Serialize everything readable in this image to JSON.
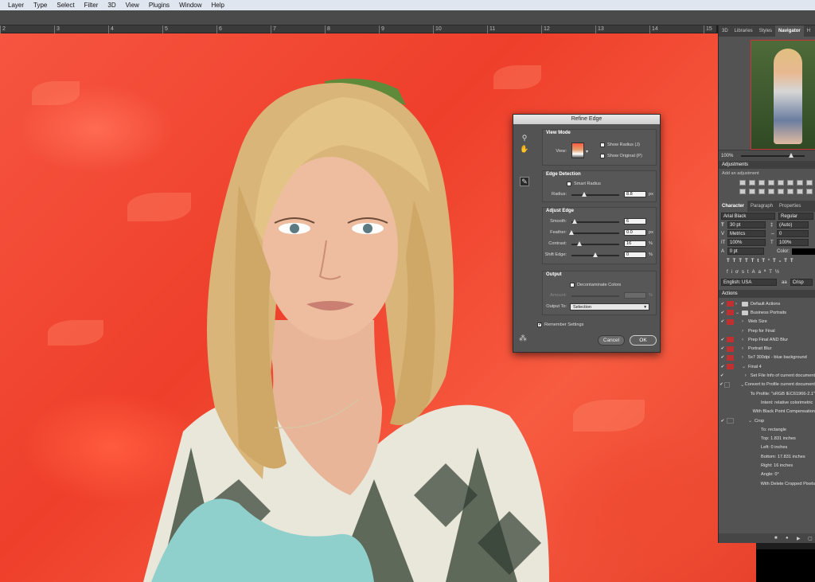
{
  "menubar": {
    "items": [
      "Layer",
      "Type",
      "Select",
      "Filter",
      "3D",
      "View",
      "Plugins",
      "Window",
      "Help"
    ]
  },
  "ruler": {
    "ticks": [
      "2",
      "3",
      "4",
      "5",
      "6",
      "7",
      "8",
      "9",
      "10",
      "11",
      "12",
      "13",
      "14",
      "15"
    ]
  },
  "dialog": {
    "title": "Refine Edge",
    "view_mode": {
      "title": "View Mode",
      "view_label": "View:",
      "show_radius": "Show Radius (J)",
      "show_original": "Show Original (P)"
    },
    "edge_detection": {
      "title": "Edge Detection",
      "smart_radius": "Smart Radius",
      "radius_label": "Radius:",
      "radius_value": "8.8",
      "radius_unit": "px",
      "radius_level": 0.27
    },
    "adjust_edge": {
      "title": "Adjust Edge",
      "smooth_label": "Smooth:",
      "smooth_value": "6",
      "smooth_level": 0.06,
      "feather_label": "Feather:",
      "feather_value": "0.0",
      "feather_unit": "px",
      "feather_level": 0.0,
      "contrast_label": "Contrast:",
      "contrast_value": "16",
      "contrast_unit": "%",
      "contrast_level": 0.16,
      "shift_label": "Shift Edge:",
      "shift_value": "0",
      "shift_unit": "%",
      "shift_level": 0.5
    },
    "output": {
      "title": "Output",
      "decontaminate": "Decontaminate Colors",
      "amount_label": "Amount:",
      "amount_unit": "%",
      "output_to_label": "Output To:",
      "output_to_value": "Selection"
    },
    "remember": "Remember Settings",
    "cancel": "Cancel",
    "ok": "OK"
  },
  "panel": {
    "tabs": [
      "3D",
      "Libraries",
      "Styles",
      "Navigator",
      "H"
    ],
    "zoom": "100%",
    "adjustments_title": "Adjustments",
    "add_adjustment": "Add an adjustment",
    "char_tabs": [
      "Character",
      "Paragraph",
      "Properties"
    ],
    "font_family": "Arial Black",
    "font_style": "Regular",
    "font_size": "30 pt",
    "leading": "(Auto)",
    "kerning": "Metrics",
    "tracking": "0",
    "vscale": "100%",
    "hscale": "100%",
    "baseline": "0 pt",
    "color_label": "Color:",
    "language": "English: USA",
    "aa": "aa",
    "antialias": "Crisp",
    "actions_title": "Actions",
    "actions": [
      {
        "label": "Default Actions",
        "indent": 0,
        "check": "✔",
        "dialog": "red",
        "twisty": "›",
        "folder": true
      },
      {
        "label": "Business Portraits",
        "indent": 0,
        "check": "✔",
        "dialog": "red",
        "twisty": "⌄",
        "folder": true
      },
      {
        "label": "Web Size",
        "indent": 1,
        "check": "✔",
        "dialog": "red",
        "twisty": "›",
        "folder": false
      },
      {
        "label": "Prep for Final",
        "indent": 1,
        "check": "",
        "dialog": "none",
        "twisty": "›",
        "folder": false
      },
      {
        "label": "Prep Final AND Blur",
        "indent": 1,
        "check": "✔",
        "dialog": "red",
        "twisty": "›",
        "folder": false
      },
      {
        "label": "Portrait Blur",
        "indent": 1,
        "check": "✔",
        "dialog": "red",
        "twisty": "›",
        "folder": false
      },
      {
        "label": "5x7 300dpi - blue background",
        "indent": 1,
        "check": "✔",
        "dialog": "red",
        "twisty": "›",
        "folder": false
      },
      {
        "label": "Final 4",
        "indent": 1,
        "check": "✔",
        "dialog": "red",
        "twisty": "⌄",
        "folder": false
      },
      {
        "label": "Set File Info of current document",
        "indent": 2,
        "check": "✔",
        "dialog": "none",
        "twisty": "›",
        "folder": false
      },
      {
        "label": "Convert to Profile current document",
        "indent": 2,
        "check": "✔",
        "dialog": "gray",
        "twisty": "⌄",
        "folder": false
      },
      {
        "label": "To Profile: \"sRGB IEC61966-2.1\"",
        "indent": 3,
        "check": "",
        "dialog": "none",
        "twisty": "",
        "folder": false
      },
      {
        "label": "Intent: relative colorimetric",
        "indent": 3,
        "check": "",
        "dialog": "none",
        "twisty": "",
        "folder": false
      },
      {
        "label": "With Black Point Compensation",
        "indent": 3,
        "check": "",
        "dialog": "none",
        "twisty": "",
        "folder": false
      },
      {
        "label": "Crop",
        "indent": 2,
        "check": "✔",
        "dialog": "gray",
        "twisty": "⌄",
        "folder": false
      },
      {
        "label": "To: rectangle",
        "indent": 3,
        "check": "",
        "dialog": "none",
        "twisty": "",
        "folder": false
      },
      {
        "label": "Top: 1.831 inches",
        "indent": 3,
        "check": "",
        "dialog": "none",
        "twisty": "",
        "folder": false
      },
      {
        "label": "Left: 0 inches",
        "indent": 3,
        "check": "",
        "dialog": "none",
        "twisty": "",
        "folder": false
      },
      {
        "label": "Bottom: 17.831 inches",
        "indent": 3,
        "check": "",
        "dialog": "none",
        "twisty": "",
        "folder": false
      },
      {
        "label": "Right: 16 inches",
        "indent": 3,
        "check": "",
        "dialog": "none",
        "twisty": "",
        "folder": false
      },
      {
        "label": "Angle: 0°",
        "indent": 3,
        "check": "",
        "dialog": "none",
        "twisty": "",
        "folder": false
      },
      {
        "label": "With Delete Cropped Pixels",
        "indent": 3,
        "check": "",
        "dialog": "none",
        "twisty": "",
        "folder": false
      }
    ]
  }
}
